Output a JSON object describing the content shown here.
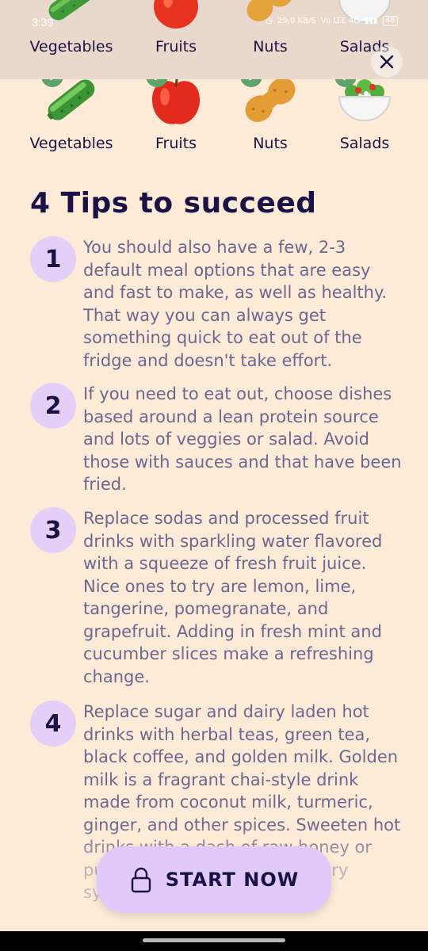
{
  "status_bar": {
    "time": "3:39",
    "net_speed": "29.0 KB/S",
    "network": "Vo LTE 4G",
    "battery": "48"
  },
  "categories": [
    {
      "label": "Vegetables",
      "icon": "cucumber-icon",
      "selected": true
    },
    {
      "label": "Fruits",
      "icon": "apple-icon",
      "selected": true
    },
    {
      "label": "Nuts",
      "icon": "peanut-icon",
      "selected": true
    },
    {
      "label": "Salads",
      "icon": "salad-bowl-icon",
      "selected": true
    }
  ],
  "tips": {
    "title": "4 Tips to succeed",
    "items": [
      {
        "number": "1",
        "text": "You should also have a few, 2-3 default meal options that are easy and fast to make, as well as healthy. That way you can always get something quick to eat out of the fridge and doesn't take effort."
      },
      {
        "number": "2",
        "text": "If you need to eat out, choose dishes based around a lean protein source and lots of veggies or salad. Avoid those with sauces and that have been fried."
      },
      {
        "number": "3",
        "text": "Replace sodas and processed fruit drinks with sparkling water flavored with a squeeze of fresh fruit juice. Nice ones to try are lemon, lime, tangerine, pomegranate, and grapefruit. Adding in fresh mint and cucumber slices make a refreshing change."
      },
      {
        "number": "4",
        "text": "Replace sugar and dairy laden hot drinks with herbal teas, green tea, black coffee, and golden milk. Golden milk is a fragrant chai-style drink made from coconut milk, turmeric, ginger, and other spices. Sweeten hot drinks with a dash of raw honey or pure maple syrup. Avoid sugary syrups."
      }
    ]
  },
  "actions": {
    "start_label": "START  NOW",
    "close_icon": "close-icon"
  },
  "colors": {
    "background": "#fdebd8",
    "badge": "#e3cff8",
    "button": "#e1c9fb",
    "check": "#5da36b",
    "title": "#1a1145",
    "body_text": "#6d6790"
  }
}
